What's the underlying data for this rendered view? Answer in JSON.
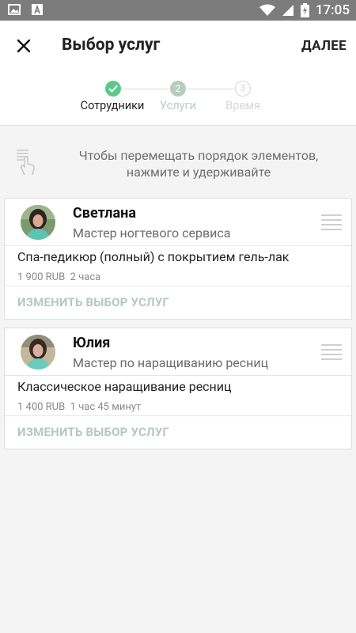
{
  "status_bar": {
    "time": "17:05",
    "left_icons": [
      "image-icon",
      "a-letter-icon"
    ],
    "right_icons": [
      "wifi-icon",
      "signal-icon",
      "battery-charging-icon"
    ]
  },
  "app_bar": {
    "close_icon": "close-icon",
    "title": "Выбор услуг",
    "next_label": "ДАЛЕЕ"
  },
  "stepper": {
    "steps": [
      {
        "number": "",
        "label": "Сотрудники",
        "state": "done"
      },
      {
        "number": "2",
        "label": "Услуги",
        "state": "current"
      },
      {
        "number": "3",
        "label": "Время",
        "state": "upcoming"
      }
    ],
    "colors": {
      "done": "#5cc98a",
      "current": "#b7cdc2",
      "upcoming": "#d6d6d6"
    }
  },
  "hint": {
    "icon": "touch-drag-icon",
    "text": "Чтобы перемещать порядок элементов, нажмите и удерживайте"
  },
  "masters": [
    {
      "name": "Светлана",
      "role": "Мастер ногтевого сервиса",
      "service": "Спа-педикюр (полный)  с покрытием гель-лак",
      "price": "1 900 RUB",
      "duration": "2 часа",
      "change_label": "ИЗМЕНИТЬ ВЫБОР УСЛУГ"
    },
    {
      "name": "Юлия",
      "role": "Мастер по наращиванию ресниц",
      "service": "Классическое наращивание ресниц",
      "price": "1 400 RUB",
      "duration": "1 час 45 минут",
      "change_label": "ИЗМЕНИТЬ ВЫБОР УСЛУГ"
    }
  ]
}
